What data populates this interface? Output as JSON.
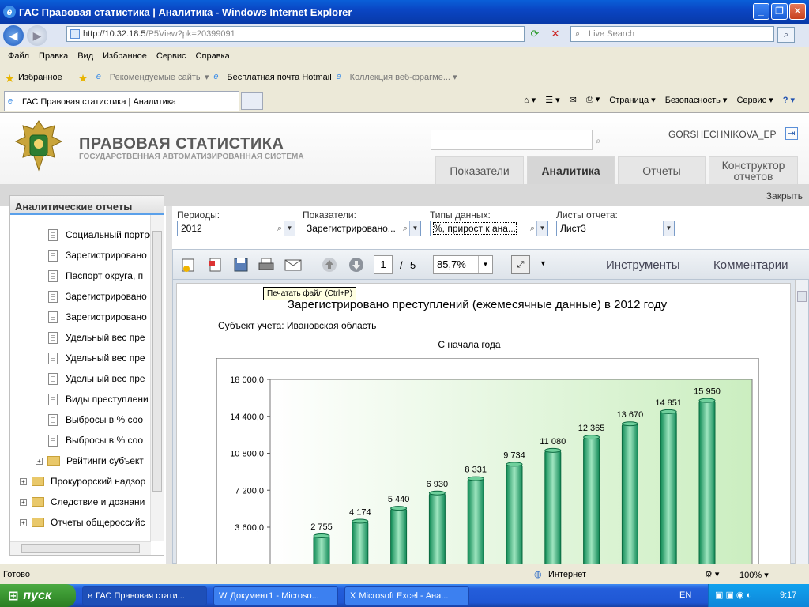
{
  "window": {
    "title": "ГАС Правовая статистика | Аналитика - Windows Internet Explorer",
    "buttons": [
      "_",
      "❐",
      "✕"
    ]
  },
  "address": {
    "prefix": "http://10.32.18.5",
    "path": "/P5View?pk=20399091",
    "search_placeholder": "Live Search"
  },
  "menu": [
    "Файл",
    "Правка",
    "Вид",
    "Избранное",
    "Сервис",
    "Справка"
  ],
  "favorites": {
    "label": "Избранное",
    "items": [
      "Рекомендуемые сайты ▾",
      "Бесплатная почта Hotmail",
      "Коллекция веб-фрагме... ▾"
    ]
  },
  "tab": {
    "label": "ГАС Правовая статистика | Аналитика"
  },
  "commands": [
    "Страница ▾",
    "Безопасность ▾",
    "Сервис ▾"
  ],
  "site": {
    "title": "ПРАВОВАЯ СТАТИСТИКА",
    "subtitle": "ГОСУДАРСТВЕННАЯ АВТОМАТИЗИРОВАННАЯ СИСТЕМА",
    "user": "GORSHECHNIKOVA_EP",
    "nav": [
      {
        "label": "Показатели"
      },
      {
        "label": "Аналитика"
      },
      {
        "label": "Отчеты"
      },
      {
        "label": "Конструктор отчетов"
      }
    ],
    "close": "Закрыть"
  },
  "left": {
    "header": "Аналитические отчеты",
    "items": [
      {
        "label": "Социальный портрет"
      },
      {
        "label": "Зарегистрировано"
      },
      {
        "label": "Паспорт округа, п"
      },
      {
        "label": "Зарегистрировано"
      },
      {
        "label": "Зарегистрировано"
      },
      {
        "label": "Удельный вес пре"
      },
      {
        "label": "Удельный вес пре"
      },
      {
        "label": "Удельный вес пре"
      },
      {
        "label": "Виды преступлени"
      },
      {
        "label": "Выбросы в % соо"
      },
      {
        "label": "Выбросы в % соо"
      }
    ],
    "folders": [
      {
        "label": "Рейтинги субъект"
      },
      {
        "label": "Прокурорский надзор"
      },
      {
        "label": "Следствие и дознани"
      },
      {
        "label": "Отчеты общероссийс"
      }
    ]
  },
  "filters": {
    "periods": {
      "label": "Периоды:",
      "value": "2012"
    },
    "indicators": {
      "label": "Показатели:",
      "value": "Зарегистрировано..."
    },
    "datatypes": {
      "label": "Типы данных:",
      "value": "%, прирост к ана..."
    },
    "sheets": {
      "label": "Листы отчета:",
      "value": "Лист3"
    }
  },
  "viewer": {
    "page": "1",
    "of": "/",
    "total": "5",
    "zoom": "85,7%",
    "tools": "Инструменты",
    "comments": "Комментарии",
    "tooltip": "Печатать файл (Ctrl+P)"
  },
  "report": {
    "title": "Зарегистрировано преступлений (ежемесячные данные) в 2012 году",
    "subject": "Субъект учета: Ивановская область",
    "since": "С начала года"
  },
  "chart_data": {
    "type": "bar",
    "values": [
      2755,
      4174,
      5440,
      6930,
      8331,
      9734,
      11080,
      12365,
      13670,
      14851,
      15950
    ],
    "value_labels": [
      "2 755",
      "4 174",
      "5 440",
      "6 930",
      "8 331",
      "9 734",
      "11 080",
      "12 365",
      "13 670",
      "14 851",
      "15 950"
    ],
    "yticks": [
      "18 000,0",
      "14 400,0",
      "10 800,0",
      "7 200,0",
      "3 600,0"
    ],
    "ytick_values": [
      18000,
      14400,
      10800,
      7200,
      3600
    ],
    "ylim": [
      0,
      18000
    ],
    "bar_color": "#2fb07a"
  },
  "status": {
    "text": "Готово",
    "zone": "Интернет",
    "zoom": "100% ▾"
  },
  "taskbar": {
    "start": "пуск",
    "tasks": [
      "ГАС Правовая стати...",
      "Документ1 - Microso...",
      "Microsoft Excel - Ана..."
    ],
    "lang": "EN",
    "clock": "9:17"
  }
}
